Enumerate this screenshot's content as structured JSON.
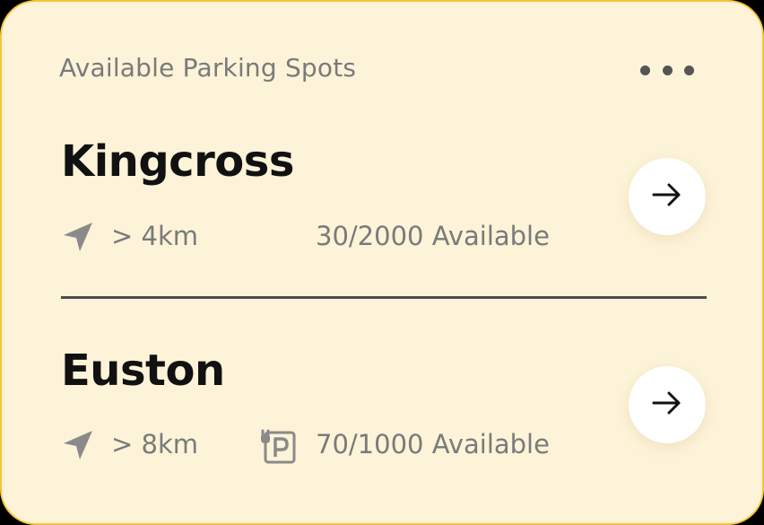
{
  "card": {
    "title": "Available Parking Spots",
    "more_icon": "more-horizontal-icon"
  },
  "spots": [
    {
      "name": "Kingcross",
      "distance": "> 4km",
      "availability": "30/2000 Available",
      "distance_icon": "navigation-arrow-icon",
      "go_icon": "arrow-right-icon"
    },
    {
      "name": "Euston",
      "distance": "> 8km",
      "availability": "70/1000 Available",
      "distance_icon": "navigation-arrow-icon",
      "feature_icon": "ev-charging-parking-icon",
      "go_icon": "arrow-right-icon"
    }
  ],
  "colors": {
    "card_background": "#fdf3d8",
    "card_border": "#f3c63a",
    "heading": "#111111",
    "muted_text": "#7a7a7a",
    "icon_gray": "#8a8a8a",
    "divider": "#4b4b48",
    "button_background": "#ffffff"
  }
}
